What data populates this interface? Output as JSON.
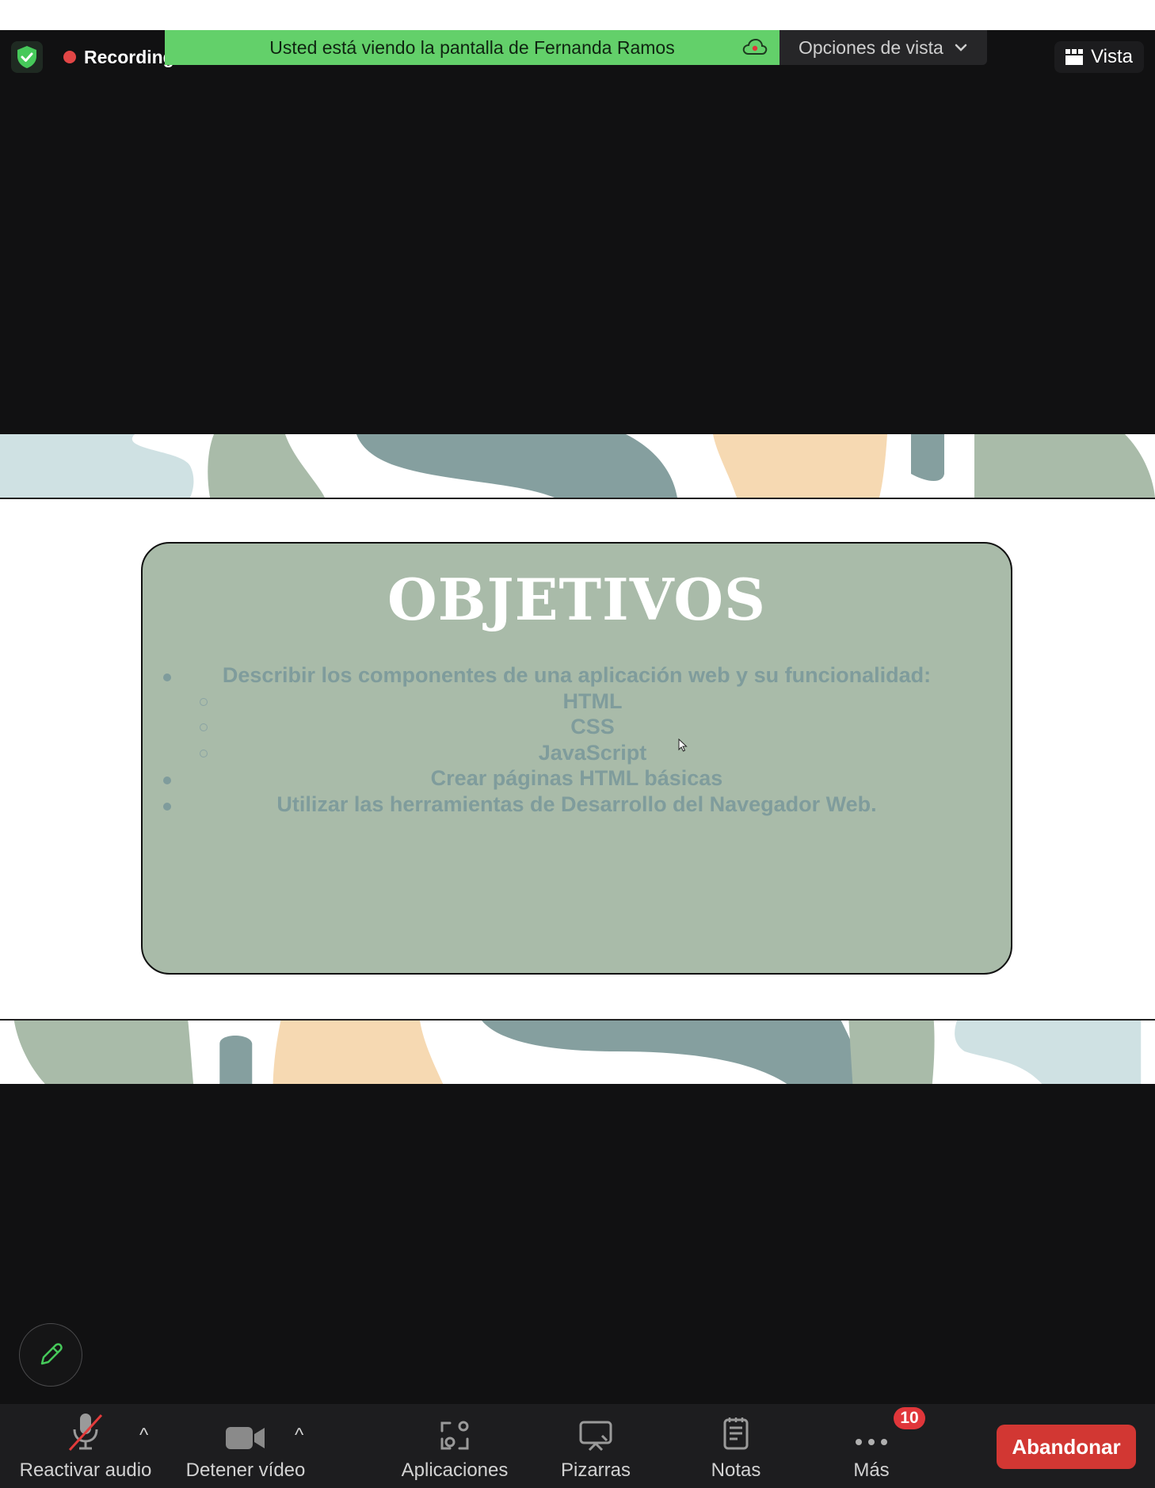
{
  "top": {
    "recording_label": "Recording",
    "share_banner": "Usted está viendo la pantalla de Fernanda Ramos",
    "view_options_label": "Opciones de vista",
    "vista_label": "Vista"
  },
  "slide": {
    "title": "OBJETIVOS",
    "items": [
      {
        "level": 1,
        "text": "Describir los componentes de una aplicación web y su funcionalidad:"
      },
      {
        "level": 2,
        "text": "HTML"
      },
      {
        "level": 2,
        "text": "CSS"
      },
      {
        "level": 2,
        "text": "JavaScript"
      },
      {
        "level": 1,
        "text": "Crear páginas HTML básicas"
      },
      {
        "level": 1,
        "text": "Utilizar las herramientas de Desarrollo del Navegador Web."
      }
    ]
  },
  "toolbar": {
    "audio_label": "Reactivar audio",
    "video_label": "Detener vídeo",
    "apps_label": "Aplicaciones",
    "whiteboards_label": "Pizarras",
    "notes_label": "Notas",
    "more_label": "Más",
    "more_badge": "10",
    "leave_label": "Abandonar"
  },
  "colors": {
    "banner_green": "#63d06a",
    "card_green": "#a9bba9",
    "slide_text": "#7f9c9c",
    "leave_red": "#d23733",
    "badge_red": "#e0363a"
  },
  "icons": [
    "shield-icon",
    "record-dot-icon",
    "cloud-record-icon",
    "chevron-down-icon",
    "grid-icon",
    "pencil-icon",
    "microphone-muted-icon",
    "video-camera-icon",
    "apps-icon",
    "whiteboard-icon",
    "notes-icon",
    "more-dots-icon",
    "cursor-icon"
  ]
}
